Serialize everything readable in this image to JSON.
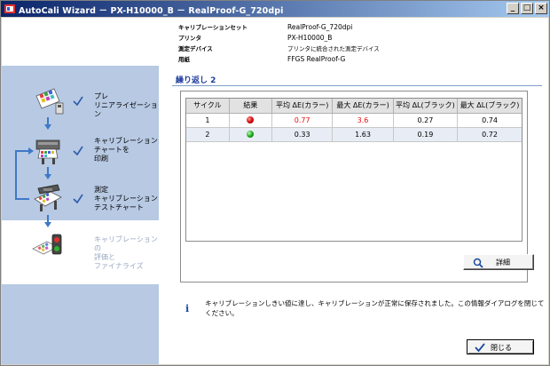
{
  "window": {
    "title": "AutoCali Wizard － PX-H10000_B － RealProof-G_720dpi",
    "controls": [
      "_",
      "□",
      "×"
    ]
  },
  "header": {
    "rows": [
      {
        "label": "キャリブレーションセット",
        "value": "RealProof-G_720dpi"
      },
      {
        "label": "プリンタ",
        "value": "PX-H10000_B"
      },
      {
        "label": "測定デバイス",
        "value": "プリンタに統合された測定デバイス"
      },
      {
        "label": "用紙",
        "value": "FFGS RealProof-G"
      }
    ]
  },
  "sidebar": {
    "steps": [
      {
        "label_lines": [
          "プレ",
          "リニアライゼーション"
        ],
        "icon": "prelinearization-icon",
        "done": true
      },
      {
        "label_lines": [
          "キャリブレーション",
          "チャートを",
          "印刷"
        ],
        "icon": "printer-icon",
        "done": true
      },
      {
        "label_lines": [
          "測定",
          "キャリブレーション",
          "テストチャート"
        ],
        "icon": "measure-icon",
        "done": true
      },
      {
        "label_lines": [
          "キャリブレーションの",
          "評価と",
          "ファイナライズ"
        ],
        "icon": "evaluate-icon",
        "done": false
      }
    ]
  },
  "main": {
    "title": "繰り返し 2",
    "table": {
      "headers": [
        "サイクル",
        "結果",
        "平均 ΔE(カラー)",
        "最大 ΔE(カラー)",
        "平均 ΔL(ブラック)",
        "最大 ΔL(ブラック)"
      ],
      "rows": [
        {
          "cycle": "1",
          "result": "red",
          "avg_de": "0.77",
          "max_de": "3.6",
          "avg_dl": "0.27",
          "max_dl": "0.74"
        },
        {
          "cycle": "2",
          "result": "green",
          "avg_de": "0.33",
          "max_de": "1.63",
          "avg_dl": "0.19",
          "max_dl": "0.72"
        }
      ]
    },
    "detail_button": "詳細",
    "message": "キャリブレーションしきい値に達し、キャリブレーションが正常に保存されました。この情報ダイアログを閉じてください。",
    "close_button": "閉じる"
  },
  "colors": {
    "title_bar_start": "#0a246a",
    "sidebar_bg": "#b7c9e3",
    "accent": "#3f78c8",
    "warning_value": "#e01010"
  }
}
